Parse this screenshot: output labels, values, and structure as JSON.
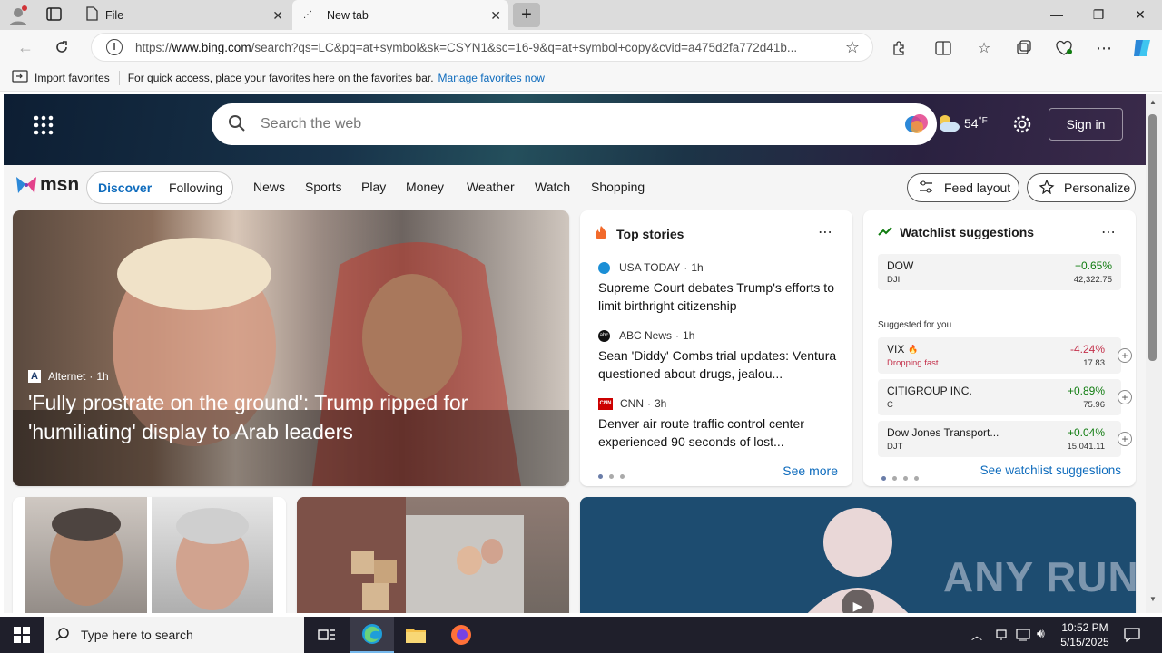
{
  "browser": {
    "tabs": [
      {
        "title": "File",
        "active": false
      },
      {
        "title": "New tab",
        "active": true
      }
    ],
    "url_prefix": "https://",
    "url_host": "www.bing.com",
    "url_rest": "/search?qs=LC&pq=at+symbol&sk=CSYN1&sc=16-9&q=at+symbol+copy&cvid=a475d2fa772d41b...",
    "favorites": {
      "import_label": "Import favorites",
      "hint": "For quick access, place your favorites here on the favorites bar.",
      "manage_link": "Manage favorites now"
    }
  },
  "hero": {
    "search_placeholder": "Search the web",
    "temperature": "54",
    "temp_unit": "°F",
    "signin_label": "Sign in"
  },
  "msn": {
    "logo_text": "msn",
    "tabs": [
      "Discover",
      "Following"
    ],
    "nav": [
      "News",
      "Sports",
      "Play",
      "Money",
      "Weather",
      "Watch",
      "Shopping"
    ],
    "feed_layout": "Feed layout",
    "personalize": "Personalize"
  },
  "main_story": {
    "source": "Alternet",
    "age": "1h",
    "headline": "'Fully prostrate on the ground': Trump ripped for 'humiliating' display to Arab leaders"
  },
  "top_stories": {
    "title": "Top stories",
    "items": [
      {
        "source": "USA TODAY",
        "age": "1h",
        "headline": "Supreme Court debates Trump's efforts to limit birthright citizenship"
      },
      {
        "source": "ABC News",
        "age": "1h",
        "headline": "Sean 'Diddy' Combs trial updates: Ventura questioned about drugs, jealou..."
      },
      {
        "source": "CNN",
        "age": "3h",
        "headline": "Denver air route traffic control center experienced 90 seconds of lost..."
      }
    ],
    "see_more": "See more"
  },
  "watchlist": {
    "title": "Watchlist suggestions",
    "primary": {
      "name": "DOW",
      "ticker": "DJI",
      "change": "+0.65%",
      "price": "42,322.75"
    },
    "suggested_label": "Suggested for you",
    "suggested": [
      {
        "name": "VIX",
        "ticker": "Dropping fast",
        "change": "-4.24%",
        "price": "17.83",
        "color": "#c4314b"
      },
      {
        "name": "CITIGROUP INC.",
        "ticker": "C",
        "change": "+0.89%",
        "price": "75.96",
        "color": "#107c10"
      },
      {
        "name": "Dow Jones Transport...",
        "ticker": "DJT",
        "change": "+0.04%",
        "price": "15,041.11",
        "color": "#107c10"
      }
    ],
    "see_link": "See watchlist suggestions"
  },
  "watermark": "ANY RUN",
  "taskbar": {
    "search_placeholder": "Type here to search",
    "time": "10:52 PM",
    "date": "5/15/2025"
  },
  "colors": {
    "accent": "#0f6cbd",
    "positive": "#107c10",
    "negative": "#c4314b"
  }
}
